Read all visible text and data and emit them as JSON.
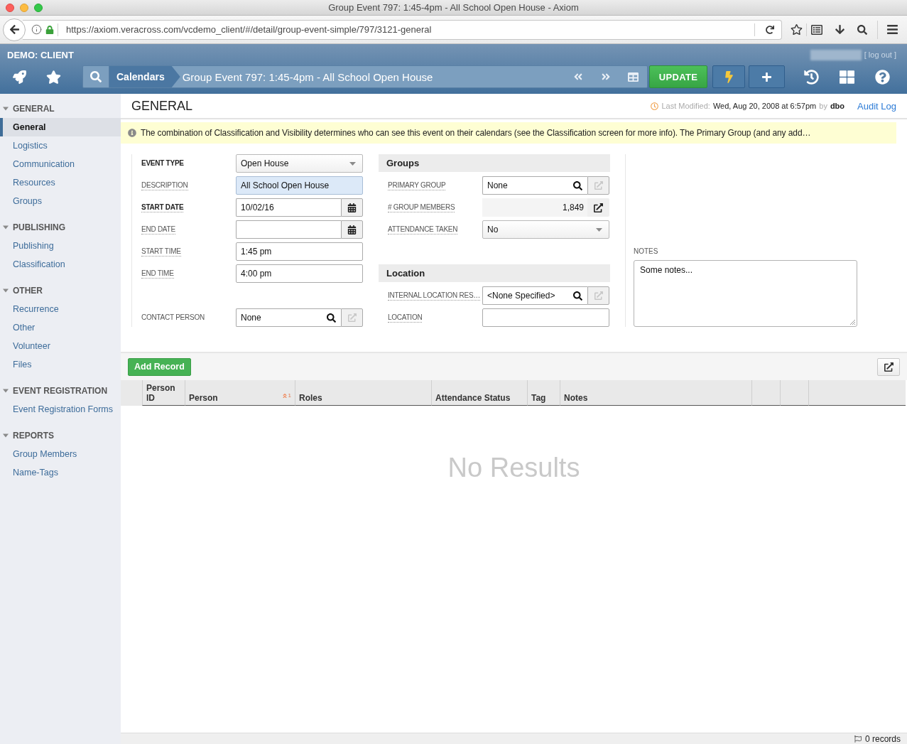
{
  "window": {
    "title": "Group Event 797: 1:45-4pm - All School Open House - Axiom"
  },
  "browser": {
    "url": "https://axiom.veracross.com/vcdemo_client/#/detail/group-event-simple/797/3121-general"
  },
  "app_header": {
    "client": "DEMO: CLIENT",
    "logout": "[ log out ]",
    "breadcrumb": "Calendars",
    "record_title": "Group Event 797: 1:45-4pm - All School Open House",
    "update_button": "UPDATE"
  },
  "sidebar": {
    "sections": [
      {
        "title": "GENERAL",
        "expanded": true,
        "items": [
          {
            "label": "General",
            "selected": true
          },
          {
            "label": "Logistics",
            "selected": false
          },
          {
            "label": "Communication",
            "selected": false
          },
          {
            "label": "Resources",
            "selected": false
          },
          {
            "label": "Groups",
            "selected": false
          }
        ]
      },
      {
        "title": "PUBLISHING",
        "expanded": true,
        "items": [
          {
            "label": "Publishing",
            "selected": false
          },
          {
            "label": "Classification",
            "selected": false
          }
        ]
      },
      {
        "title": "OTHER",
        "expanded": true,
        "items": [
          {
            "label": "Recurrence",
            "selected": false
          },
          {
            "label": "Other",
            "selected": false
          },
          {
            "label": "Volunteer",
            "selected": false
          },
          {
            "label": "Files",
            "selected": false
          }
        ]
      },
      {
        "title": "EVENT REGISTRATION",
        "expanded": true,
        "items": [
          {
            "label": "Event Registration Forms",
            "selected": false
          }
        ]
      },
      {
        "title": "REPORTS",
        "expanded": true,
        "items": [
          {
            "label": "Group Members",
            "selected": false
          },
          {
            "label": "Name-Tags",
            "selected": false
          }
        ]
      }
    ]
  },
  "page": {
    "title": "GENERAL",
    "last_modified_label": "Last Modified:",
    "last_modified": "Wed, Aug 20, 2008 at 6:57pm",
    "by_label": "by",
    "modified_by": "dbo",
    "audit_log": "Audit Log",
    "notice": "The combination of Classification and Visibility determines who can see this event on their calendars (see the Classification screen for more info). The Primary Group (and any add…"
  },
  "form": {
    "event_fields": [
      {
        "kind": "select",
        "label": "EVENT TYPE",
        "required": true,
        "hint": false,
        "focused": false,
        "value": "Open House"
      },
      {
        "kind": "text",
        "label": "DESCRIPTION",
        "required": false,
        "hint": true,
        "focused": true,
        "value": "All School Open House"
      },
      {
        "kind": "date",
        "label": "START DATE",
        "required": true,
        "hint": true,
        "focused": false,
        "value": "10/02/16"
      },
      {
        "kind": "date",
        "label": "END DATE",
        "required": false,
        "hint": true,
        "focused": false
      },
      {
        "kind": "text",
        "label": "START TIME",
        "required": false,
        "hint": true,
        "focused": false,
        "value": "1:45 pm"
      },
      {
        "kind": "text",
        "label": "END TIME",
        "required": false,
        "hint": true,
        "focused": false,
        "value": "4:00 pm"
      }
    ],
    "contact_fields": [
      {
        "kind": "lookup",
        "label": "CONTACT PERSON",
        "required": false,
        "hint": false,
        "focused": false,
        "value": "None",
        "link_enabled": false
      }
    ],
    "groups": {
      "title": "Groups",
      "fields": [
        {
          "kind": "lookup",
          "label": "PRIMARY GROUP",
          "required": false,
          "hint": true,
          "focused": false,
          "value": "None",
          "link_enabled": false
        },
        {
          "kind": "readonly",
          "label": "# GROUP MEMBERS",
          "required": false,
          "hint": true,
          "focused": false,
          "value": "1,849",
          "link_enabled": true
        },
        {
          "kind": "select",
          "label": "ATTENDANCE TAKEN",
          "required": false,
          "hint": true,
          "focused": false,
          "value": "No"
        }
      ]
    },
    "location": {
      "title": "Location",
      "fields": [
        {
          "kind": "lookup",
          "label": "INTERNAL LOCATION RES…",
          "required": false,
          "hint": true,
          "focused": false,
          "value": "<None Specified>",
          "link_enabled": false
        },
        {
          "kind": "text",
          "label": "LOCATION",
          "required": false,
          "hint": true,
          "focused": false
        }
      ]
    },
    "notes": {
      "label": "NOTES",
      "value": "Some notes..."
    }
  },
  "records": {
    "add_button": "Add Record",
    "columns": [
      {
        "label": "Person ID"
      },
      {
        "label": "Person",
        "sort_rank": "1"
      },
      {
        "label": "Roles"
      },
      {
        "label": "Attendance Status"
      },
      {
        "label": "Tag"
      },
      {
        "label": "Notes"
      }
    ],
    "empty_message": "No Results",
    "count": "0 records"
  }
}
